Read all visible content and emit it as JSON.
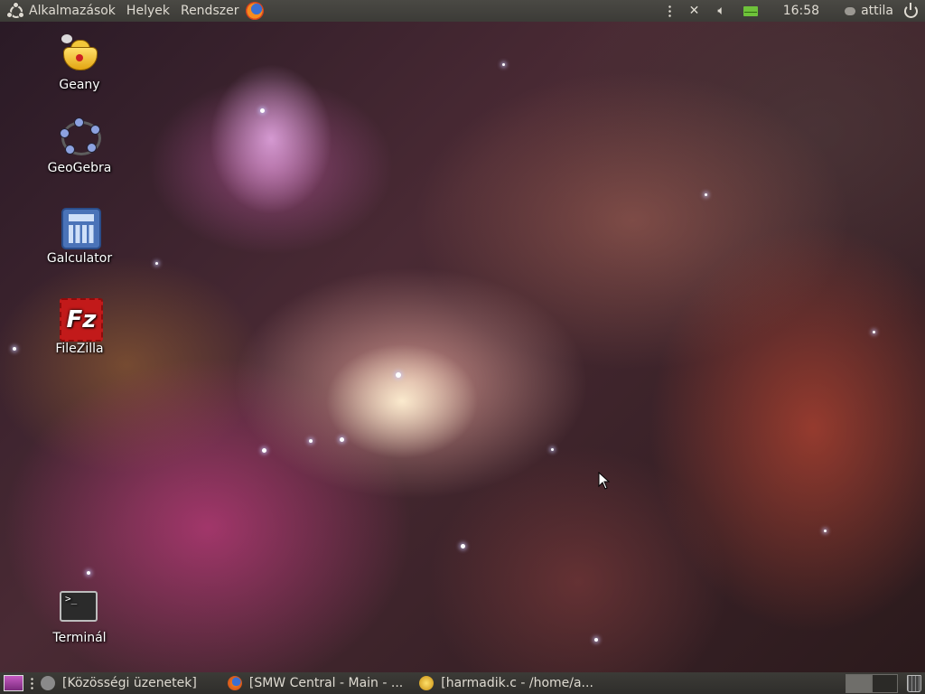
{
  "top_panel": {
    "menus": [
      "Alkalmazások",
      "Helyek",
      "Rendszer"
    ],
    "clock": "16:58",
    "username": "attila",
    "icons": [
      "ubuntu-logo-icon",
      "firefox-icon",
      "handle-icon",
      "network-disconnected-icon",
      "volume-icon",
      "mail-icon",
      "chat-icon",
      "power-icon"
    ]
  },
  "desktop": {
    "icons": [
      {
        "label": "Geany",
        "icon": "geany-icon"
      },
      {
        "label": "GeoGebra",
        "icon": "geogebra-icon"
      },
      {
        "label": "Galculator",
        "icon": "calculator-icon"
      },
      {
        "label": "FileZilla",
        "icon": "filezilla-icon"
      },
      {
        "label": "Terminál",
        "icon": "terminal-icon"
      }
    ],
    "filezilla_glyph": "Fz",
    "terminal_glyph": ">_"
  },
  "bottom_panel": {
    "tasks": [
      {
        "label": "[Közösségi üzenetek]",
        "icon": "chat-icon"
      },
      {
        "label": "[SMW Central - Main - ...",
        "icon": "firefox-icon"
      },
      {
        "label": "[harmadik.c - /home/a...",
        "icon": "geany-icon"
      }
    ],
    "workspaces": 2,
    "active_workspace": 1
  }
}
